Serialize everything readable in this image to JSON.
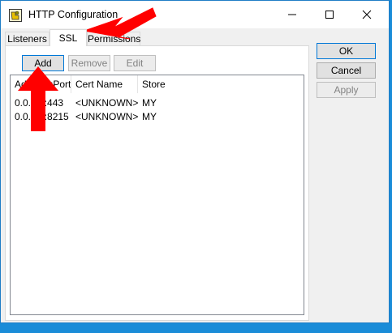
{
  "window": {
    "title": "HTTP Configuration"
  },
  "tabs": [
    {
      "label": "Listeners"
    },
    {
      "label": "SSL"
    },
    {
      "label": "Permissions"
    }
  ],
  "toolbar": {
    "add_label": "Add",
    "remove_label": "Remove",
    "edit_label": "Edit"
  },
  "list": {
    "columns": [
      "Address:Port",
      "Cert Name",
      "Store"
    ],
    "rows": [
      {
        "address": "0.0.0.0:443",
        "cert": "<UNKNOWN>",
        "store": "MY"
      },
      {
        "address": "0.0.0.0:8215",
        "cert": "<UNKNOWN>",
        "store": "MY"
      }
    ]
  },
  "dialog_buttons": {
    "ok": "OK",
    "cancel": "Cancel",
    "apply": "Apply"
  },
  "colors": {
    "annotation_arrow": "#ff0000",
    "desktop": "#1a8cd8"
  }
}
